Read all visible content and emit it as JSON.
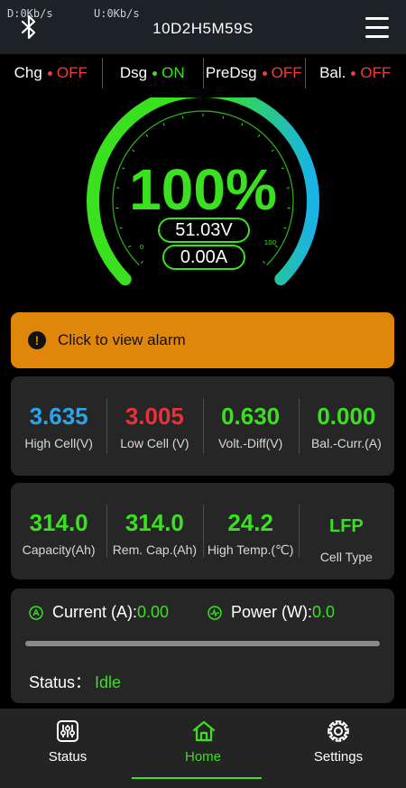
{
  "header": {
    "download_rate": "D:0Kb/s",
    "upload_rate": "U:0Kb/s",
    "device_name": "10D2H5M59S",
    "icons": {
      "left": "bluetooth-icon",
      "right": "menu-icon"
    }
  },
  "switches": [
    {
      "name": "Chg",
      "state": "OFF",
      "color": "#f23a3a"
    },
    {
      "name": "Dsg",
      "state": "ON",
      "color": "#39e11f"
    },
    {
      "name": "PreDsg",
      "state": "OFF",
      "color": "#f23a3a"
    },
    {
      "name": "Bal.",
      "state": "OFF",
      "color": "#f23a3a"
    }
  ],
  "gauge": {
    "soc_text": "100%",
    "soc_percent": 100,
    "voltage": "51.03V",
    "current": "0.00A",
    "scale_min": "0",
    "scale_max": "100"
  },
  "alarm": {
    "label": "Click to view alarm",
    "icon": "alert-icon",
    "color": "#e0860a"
  },
  "cells_card": [
    {
      "value": "3.635",
      "label": "High Cell(V)",
      "color": "#2da3e8"
    },
    {
      "value": "3.005",
      "label": "Low Cell (V)",
      "color": "#e8323a"
    },
    {
      "value": "0.630",
      "label": "Volt.-Diff(V)",
      "color": "#39e11f"
    },
    {
      "value": "0.000",
      "label": "Bal.-Curr.(A)",
      "color": "#39e11f"
    }
  ],
  "capacity_card": [
    {
      "value": "314.0",
      "label": "Capacity(Ah)"
    },
    {
      "value": "314.0",
      "label": "Rem. Cap.(Ah)"
    },
    {
      "value": "24.2",
      "label": "High Temp.(℃)"
    },
    {
      "value": "LFP",
      "label": "Cell Type"
    }
  ],
  "power_card": {
    "current_label": "Current (A):",
    "current_value": "0.00",
    "power_label": "Power (W):",
    "power_value": "0.0",
    "load_fraction": 0,
    "status_label": "Status：",
    "status_value": "Idle"
  },
  "nav": [
    {
      "label": "Status",
      "icon": "status-sliders-icon"
    },
    {
      "label": "Home",
      "icon": "home-icon",
      "active": true
    },
    {
      "label": "Settings",
      "icon": "gear-icon"
    }
  ],
  "accent_color": "#39e11f"
}
